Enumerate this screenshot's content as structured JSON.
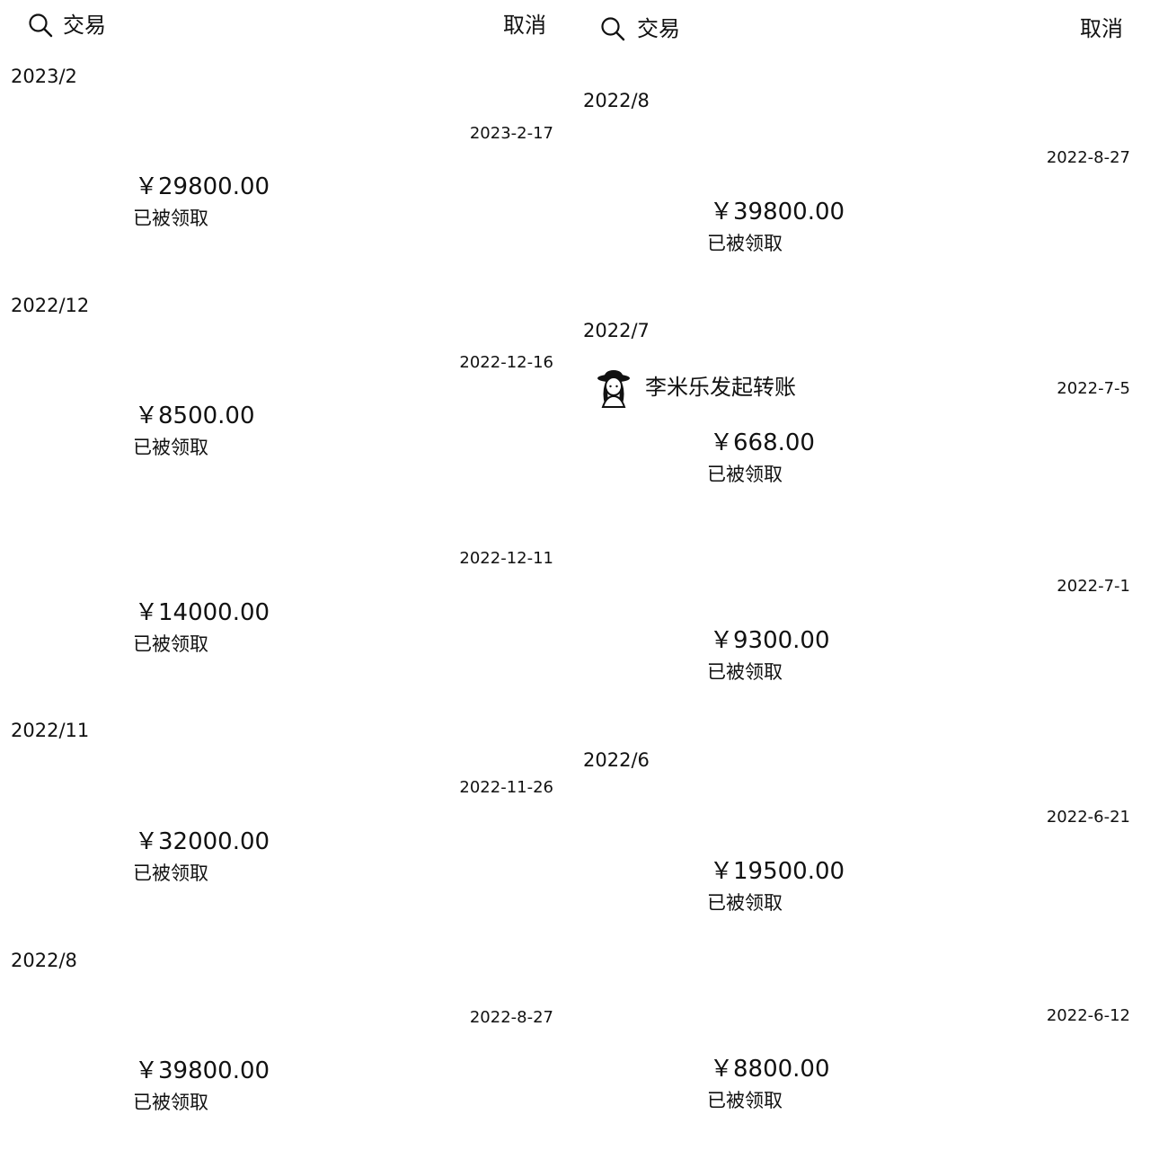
{
  "panels": [
    {
      "search": {
        "label": "交易",
        "icon": "search-icon"
      },
      "cancel_label": "取消",
      "months": [
        "2023/2",
        "2022/12",
        "2022/11",
        "2022/8"
      ],
      "transactions": [
        {
          "date": "2023-2-17",
          "amount": "￥29800.00",
          "status": "已被领取"
        },
        {
          "date": "2022-12-16",
          "amount": "￥8500.00",
          "status": "已被领取"
        },
        {
          "date": "2022-12-11",
          "amount": "￥14000.00",
          "status": "已被领取"
        },
        {
          "date": "2022-11-26",
          "amount": "￥32000.00",
          "status": "已被领取"
        },
        {
          "date": "2022-8-27",
          "amount": "￥39800.00",
          "status": "已被领取"
        }
      ]
    },
    {
      "search": {
        "label": "交易",
        "icon": "search-icon"
      },
      "cancel_label": "取消",
      "months": [
        "2022/8",
        "2022/7",
        "2022/6"
      ],
      "transactions": [
        {
          "date": "2022-8-27",
          "amount": "￥39800.00",
          "status": "已被领取"
        },
        {
          "date": "2022-7-5",
          "amount": "￥668.00",
          "status": "已被领取",
          "initiator": "李米乐发起转账",
          "avatar": "avatar-icon"
        },
        {
          "date": "2022-7-1",
          "amount": "￥9300.00",
          "status": "已被领取"
        },
        {
          "date": "2022-6-21",
          "amount": "￥19500.00",
          "status": "已被领取"
        },
        {
          "date": "2022-6-12",
          "amount": "￥8800.00",
          "status": "已被领取"
        }
      ]
    }
  ]
}
